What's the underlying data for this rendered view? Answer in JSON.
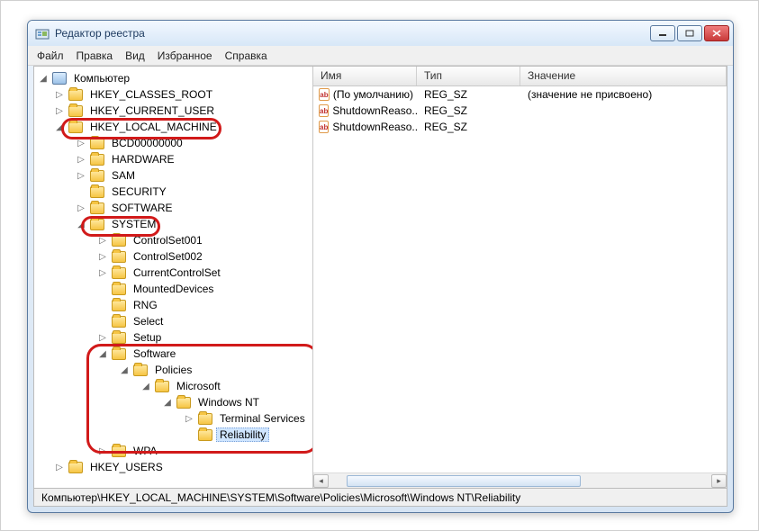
{
  "window": {
    "title": "Редактор реестра"
  },
  "menu": {
    "file": "Файл",
    "edit": "Правка",
    "view": "Вид",
    "favorites": "Избранное",
    "help": "Справка"
  },
  "tree": {
    "root": "Компьютер",
    "hkcr": "HKEY_CLASSES_ROOT",
    "hkcu": "HKEY_CURRENT_USER",
    "hklm": "HKEY_LOCAL_MACHINE",
    "bcd": "BCD00000000",
    "hardware": "HARDWARE",
    "sam": "SAM",
    "security": "SECURITY",
    "software": "SOFTWARE",
    "system": "SYSTEM",
    "cs1": "ControlSet001",
    "cs2": "ControlSet002",
    "ccs": "CurrentControlSet",
    "mounted": "MountedDevices",
    "rng": "RNG",
    "select": "Select",
    "setup": "Setup",
    "software2": "Software",
    "policies": "Policies",
    "microsoft": "Microsoft",
    "winnt": "Windows NT",
    "termsvc": "Terminal Services",
    "reliability": "Reliability",
    "wpa": "WPA",
    "hkeyusers": "HKEY_USERS"
  },
  "list": {
    "col_name": "Имя",
    "col_type": "Тип",
    "col_value": "Значение",
    "rows": [
      {
        "name": "(По умолчанию)",
        "type": "REG_SZ",
        "value": "(значение не присвоено)"
      },
      {
        "name": "ShutdownReaso...",
        "type": "REG_SZ",
        "value": ""
      },
      {
        "name": "ShutdownReaso...",
        "type": "REG_SZ",
        "value": ""
      }
    ]
  },
  "status": {
    "path": "Компьютер\\HKEY_LOCAL_MACHINE\\SYSTEM\\Software\\Policies\\Microsoft\\Windows NT\\Reliability"
  },
  "icons": {
    "ab": "ab"
  }
}
